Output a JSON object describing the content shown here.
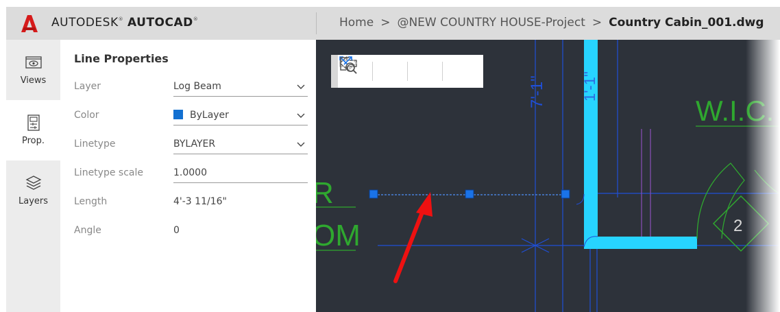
{
  "brand": {
    "name_light": "AUTODESK",
    "name_bold": "AUTOCAD",
    "mark": "®"
  },
  "breadcrumb": {
    "items": [
      "Home",
      "@NEW COUNTRY HOUSE-Project",
      "Country Cabin_001.dwg"
    ],
    "separator": ">"
  },
  "rail": {
    "items": [
      {
        "label": "Views",
        "icon": "eye-icon"
      },
      {
        "label": "Prop.",
        "icon": "properties-icon"
      },
      {
        "label": "Layers",
        "icon": "layers-icon"
      }
    ],
    "active": "Prop."
  },
  "panel": {
    "title": "Line Properties",
    "properties": {
      "layer": {
        "label": "Layer",
        "value": "Log Beam"
      },
      "color": {
        "label": "Color",
        "value": "ByLayer",
        "swatch": "#1270d1"
      },
      "linetype": {
        "label": "Linetype",
        "value": "BYLAYER"
      },
      "linetype_scale": {
        "label": "Linetype scale",
        "value": "1.0000"
      },
      "length": {
        "label": "Length",
        "value": "4'-3 11/16\""
      },
      "angle": {
        "label": "Angle",
        "value": "0"
      }
    }
  },
  "toolbar": {
    "buttons": [
      "undo-icon",
      "redo-icon",
      "zoom-extents-icon",
      "zoom-window-icon"
    ]
  },
  "drawing": {
    "labels": {
      "room_left_top": "R",
      "room_left_bottom": "OM",
      "wic": "W.I.C.",
      "dimension": "7'-1\"",
      "dimension2": "1'-1\"",
      "door_number": "2"
    },
    "colors": {
      "background": "#2d323a",
      "wall": "#27d4ff",
      "line": "#1f4fd8",
      "text_green": "#2fa82f",
      "grip": "#1a73e8",
      "annotation_arrow": "#ee1111"
    }
  }
}
